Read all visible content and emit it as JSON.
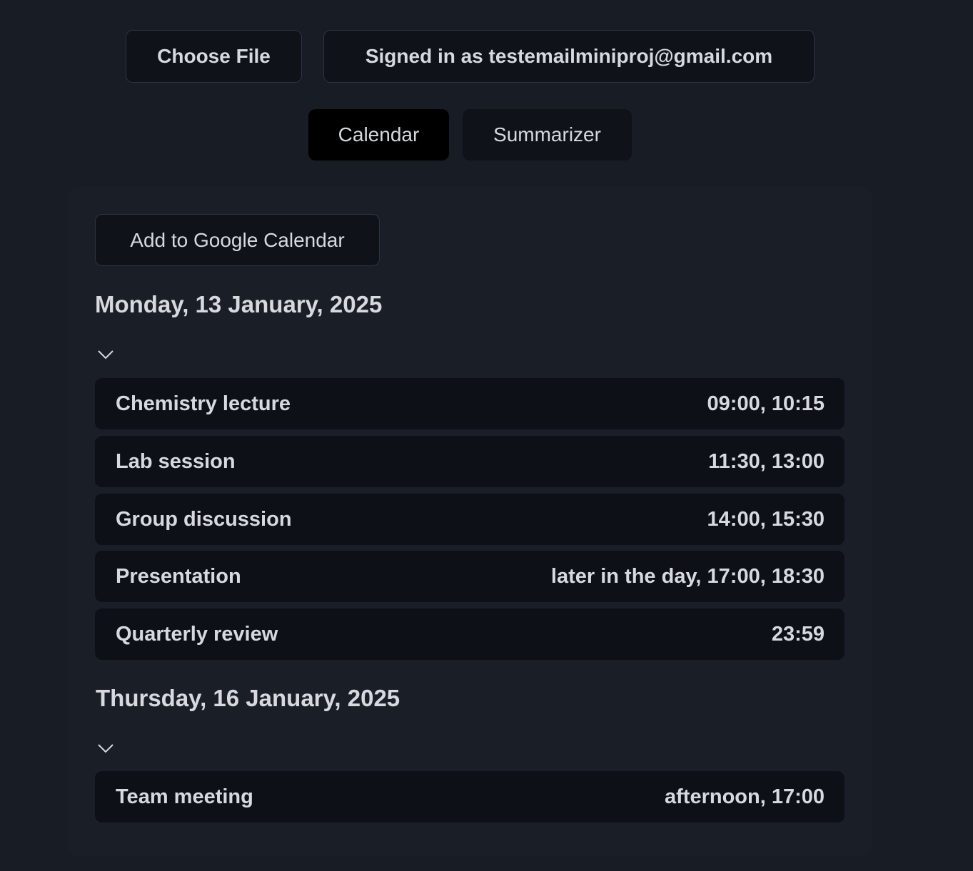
{
  "header": {
    "choose_file_label": "Choose File",
    "signed_in_label": "Signed in as testemailminiproj@gmail.com"
  },
  "tabs": [
    {
      "label": "Calendar",
      "active": true
    },
    {
      "label": "Summarizer",
      "active": false
    }
  ],
  "panel": {
    "add_button_label": "Add to Google Calendar",
    "days": [
      {
        "heading": "Monday, 13 January, 2025",
        "events": [
          {
            "title": "Chemistry lecture",
            "time": "09:00, 10:15"
          },
          {
            "title": "Lab session",
            "time": "11:30, 13:00"
          },
          {
            "title": "Group discussion",
            "time": "14:00, 15:30"
          },
          {
            "title": "Presentation",
            "time": "later in the day, 17:00, 18:30"
          },
          {
            "title": "Quarterly review",
            "time": "23:59"
          }
        ]
      },
      {
        "heading": "Thursday, 16 January, 2025",
        "events": [
          {
            "title": "Team meeting",
            "time": "afternoon, 17:00"
          }
        ]
      }
    ]
  },
  "colors": {
    "background": "#181c24",
    "panel": "#1a1e26",
    "row": "#0d1017",
    "active_tab": "#000000",
    "text": "#d6d9de"
  },
  "icons": {
    "collapse": "chevron-down-icon"
  }
}
